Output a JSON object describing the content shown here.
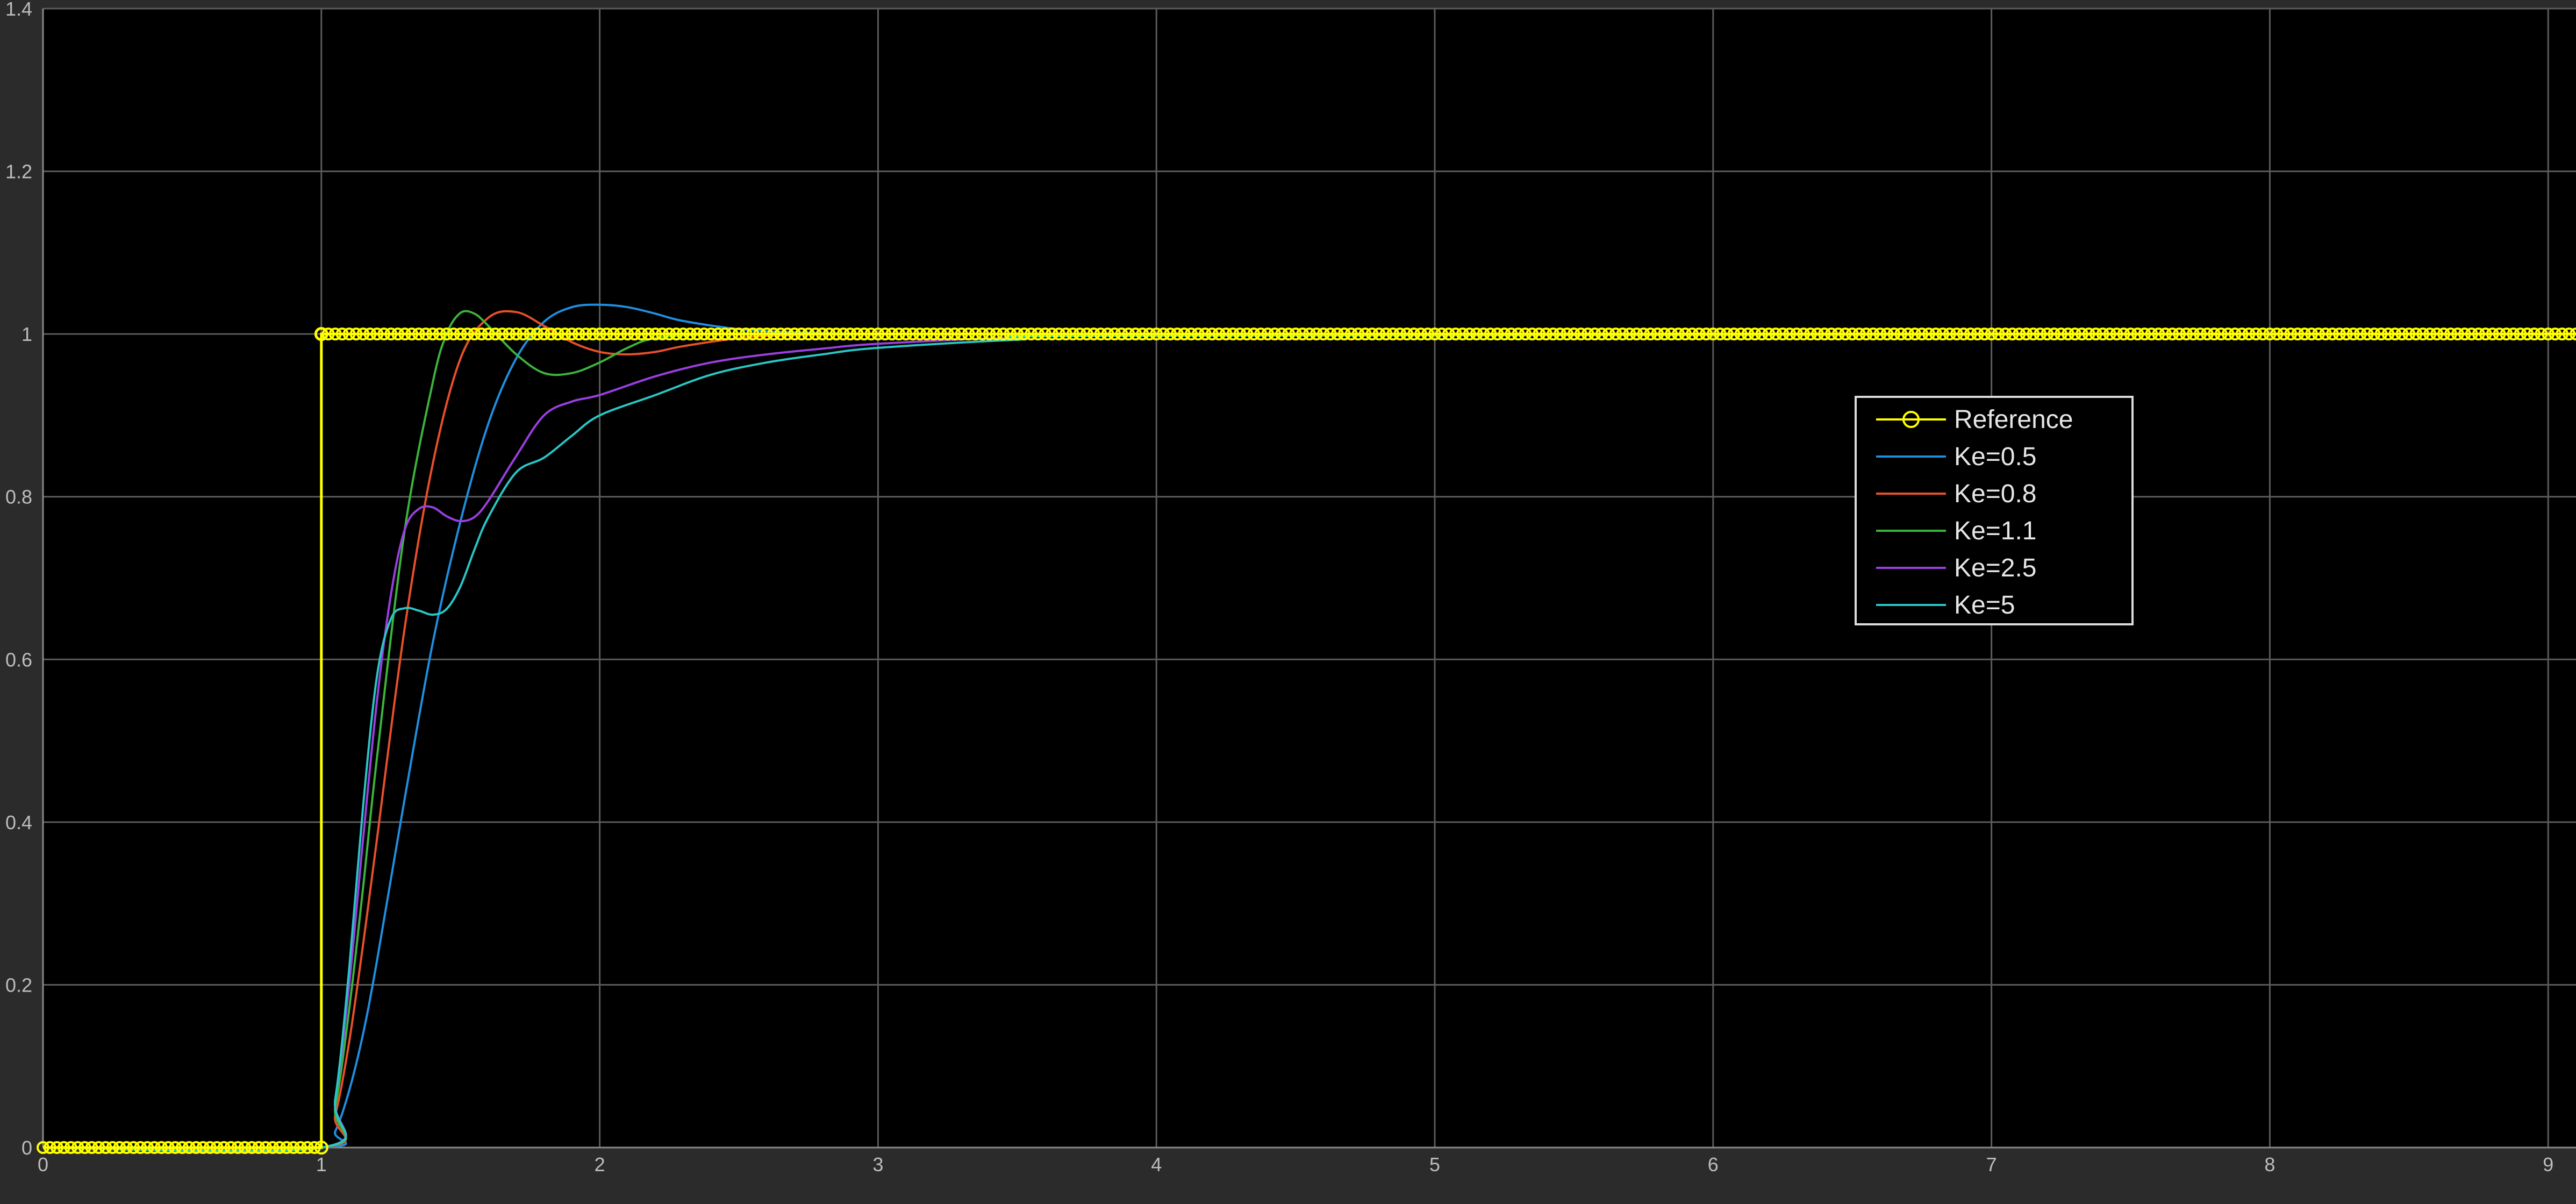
{
  "chart_data": {
    "type": "line",
    "title": "",
    "xlabel": "",
    "ylabel": "",
    "xlim": [
      0,
      9.1
    ],
    "ylim": [
      0,
      1.4
    ],
    "x_ticks": [
      "0",
      "1",
      "2",
      "3",
      "4",
      "5",
      "6",
      "7",
      "8",
      "9"
    ],
    "y_ticks": [
      "0",
      "0.2",
      "0.4",
      "0.6",
      "0.8",
      "1",
      "1.2",
      "1.4"
    ],
    "grid": true,
    "legend_position": "right-center",
    "colors": {
      "figure_background": "#2b2b2b",
      "axes_background": "#000000",
      "grid": "#5a5a5a",
      "tick_label": "#bdbdbd",
      "legend_border": "#dcdcdc",
      "legend_text": "#e6e6e6"
    },
    "series": [
      {
        "name": "Reference",
        "color": "#ffff00",
        "marker": "circle",
        "x": [
          0,
          0.1,
          0.2,
          0.3,
          0.4,
          0.5,
          0.6,
          0.7,
          0.8,
          0.9,
          1.0,
          1.0,
          1.1,
          1.2,
          1.3,
          1.4,
          1.5,
          1.6,
          1.7,
          1.8,
          1.9,
          2.0,
          2.2,
          2.4,
          2.6,
          2.8,
          3.0,
          3.5,
          4.0,
          4.5,
          5.0,
          5.5,
          6.0,
          6.5,
          7.0,
          7.5,
          8.0,
          8.5,
          9.0,
          9.1
        ],
        "y": [
          0,
          0,
          0,
          0,
          0,
          0,
          0,
          0,
          0,
          0,
          0,
          1,
          1,
          1,
          1,
          1,
          1,
          1,
          1,
          1,
          1,
          1,
          1,
          1,
          1,
          1,
          1,
          1,
          1,
          1,
          1,
          1,
          1,
          1,
          1,
          1,
          1,
          1,
          1,
          1
        ]
      },
      {
        "name": "Ke=0.5",
        "color": "#1f8fe0",
        "x": [
          0,
          1.0,
          1.05,
          1.1,
          1.15,
          1.2,
          1.3,
          1.4,
          1.5,
          1.6,
          1.7,
          1.8,
          1.9,
          2.0,
          2.1,
          2.2,
          2.3,
          2.5,
          2.7,
          3.0,
          3.5,
          4.0,
          9.1
        ],
        "y": [
          0,
          0,
          0.02,
          0.07,
          0.14,
          0.23,
          0.43,
          0.62,
          0.77,
          0.89,
          0.97,
          1.015,
          1.033,
          1.036,
          1.033,
          1.025,
          1.016,
          1.006,
          1.002,
          1.0,
          1.0,
          1.0,
          1.0
        ]
      },
      {
        "name": "Ke=0.8",
        "color": "#e8502a",
        "x": [
          0,
          1.0,
          1.05,
          1.1,
          1.15,
          1.2,
          1.3,
          1.4,
          1.5,
          1.6,
          1.7,
          1.8,
          1.9,
          2.0,
          2.1,
          2.2,
          2.3,
          2.5,
          2.7,
          3.0,
          3.5,
          4.0,
          9.1
        ],
        "y": [
          0,
          0,
          0.04,
          0.13,
          0.25,
          0.38,
          0.64,
          0.84,
          0.97,
          1.02,
          1.027,
          1.01,
          0.99,
          0.978,
          0.975,
          0.978,
          0.985,
          0.995,
          0.999,
          1.0,
          1.0,
          1.0,
          1.0
        ]
      },
      {
        "name": "Ke=1.1",
        "color": "#3cb43c",
        "x": [
          0,
          1.0,
          1.05,
          1.1,
          1.15,
          1.2,
          1.3,
          1.4,
          1.45,
          1.5,
          1.55,
          1.6,
          1.7,
          1.8,
          1.9,
          2.0,
          2.1,
          2.2,
          2.4,
          2.6,
          2.8,
          3.0,
          4.0,
          9.1
        ],
        "y": [
          0,
          0,
          0.05,
          0.17,
          0.32,
          0.48,
          0.76,
          0.94,
          1.0,
          1.026,
          1.025,
          1.01,
          0.975,
          0.952,
          0.952,
          0.965,
          0.983,
          0.995,
          1.0,
          1.0,
          1.0,
          1.0,
          1.0,
          1.0
        ]
      },
      {
        "name": "Ke=2.5",
        "color": "#9b3fe0",
        "x": [
          0,
          1.0,
          1.05,
          1.1,
          1.15,
          1.2,
          1.25,
          1.3,
          1.35,
          1.4,
          1.45,
          1.5,
          1.55,
          1.6,
          1.7,
          1.8,
          1.9,
          2.0,
          2.2,
          2.4,
          2.6,
          2.8,
          3.0,
          3.5,
          4.0,
          9.1
        ],
        "y": [
          0,
          0,
          0.06,
          0.2,
          0.38,
          0.55,
          0.68,
          0.76,
          0.785,
          0.787,
          0.776,
          0.77,
          0.775,
          0.795,
          0.85,
          0.9,
          0.917,
          0.925,
          0.948,
          0.965,
          0.975,
          0.982,
          0.988,
          0.996,
          1.0,
          1.0
        ]
      },
      {
        "name": "Ke=5",
        "color": "#29c6c6",
        "x": [
          0,
          1.0,
          1.05,
          1.1,
          1.15,
          1.2,
          1.25,
          1.3,
          1.35,
          1.4,
          1.45,
          1.5,
          1.55,
          1.6,
          1.7,
          1.8,
          1.9,
          2.0,
          2.2,
          2.4,
          2.6,
          2.8,
          3.0,
          3.5,
          4.0,
          9.1
        ],
        "y": [
          0,
          0,
          0.06,
          0.22,
          0.42,
          0.58,
          0.65,
          0.663,
          0.66,
          0.655,
          0.662,
          0.69,
          0.735,
          0.775,
          0.83,
          0.848,
          0.875,
          0.9,
          0.925,
          0.95,
          0.965,
          0.975,
          0.983,
          0.993,
          0.998,
          1.0
        ]
      }
    ]
  }
}
